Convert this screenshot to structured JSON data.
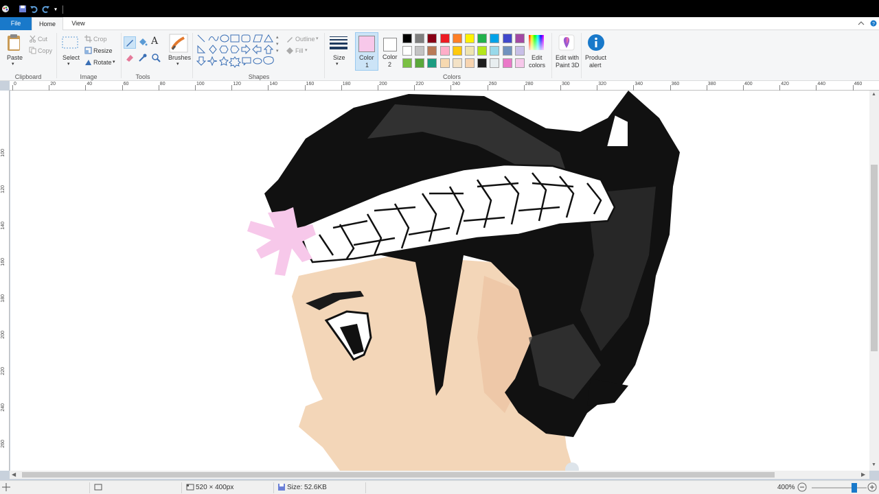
{
  "tabs": {
    "file": "File",
    "home": "Home",
    "view": "View"
  },
  "clipboard": {
    "paste": "Paste",
    "cut": "Cut",
    "copy": "Copy",
    "group": "Clipboard"
  },
  "image": {
    "select": "Select",
    "crop": "Crop",
    "resize": "Resize",
    "rotate": "Rotate",
    "group": "Image"
  },
  "tools": {
    "group": "Tools",
    "brushes": "Brushes"
  },
  "shapes": {
    "outline": "Outline",
    "fill": "Fill",
    "group": "Shapes"
  },
  "size": {
    "label": "Size"
  },
  "colors": {
    "color1_line1": "Color",
    "color1_line2": "1",
    "color2_line1": "Color",
    "color2_line2": "2",
    "group": "Colors",
    "edit_line1": "Edit",
    "edit_line2": "colors",
    "color1_value": "#f7c8ea",
    "color2_value": "#ffffff",
    "palette_row1": [
      "#000000",
      "#7f7f7f",
      "#880015",
      "#ed1c24",
      "#ff7f27",
      "#fff200",
      "#22b14c",
      "#00a2e8",
      "#3f48cc",
      "#a349a4"
    ],
    "palette_row2": [
      "#ffffff",
      "#c3c3c3",
      "#b97a57",
      "#ffaec9",
      "#ffc90e",
      "#efe4b0",
      "#b5e61d",
      "#99d9ea",
      "#7092be",
      "#c8bfe7"
    ],
    "palette_row3": [
      "#7ac043",
      "#5aa83a",
      "#1c9c80",
      "#f7d9b0",
      "#f3e2c6",
      "#f7d4b0",
      "#1e1e1e",
      "#e8eef0",
      "#ea79c8",
      "#f7c8ea"
    ]
  },
  "paint3d": {
    "line1": "Edit with",
    "line2": "Paint 3D"
  },
  "product": {
    "line1": "Product",
    "line2": "alert"
  },
  "ruler": {
    "top": [
      "0",
      "20",
      "40",
      "60",
      "80",
      "100",
      "120",
      "140",
      "160",
      "180",
      "200",
      "220",
      "240",
      "260",
      "280",
      "300",
      "320",
      "340",
      "360",
      "380",
      "400",
      "420",
      "440",
      "460"
    ],
    "left": [
      "100",
      "120",
      "140",
      "160",
      "180",
      "200",
      "220",
      "240",
      "260"
    ]
  },
  "status": {
    "dimensions": "520 × 400px",
    "size": "Size: 52.6KB",
    "zoom": "400%",
    "zoom_level": 0.8
  }
}
